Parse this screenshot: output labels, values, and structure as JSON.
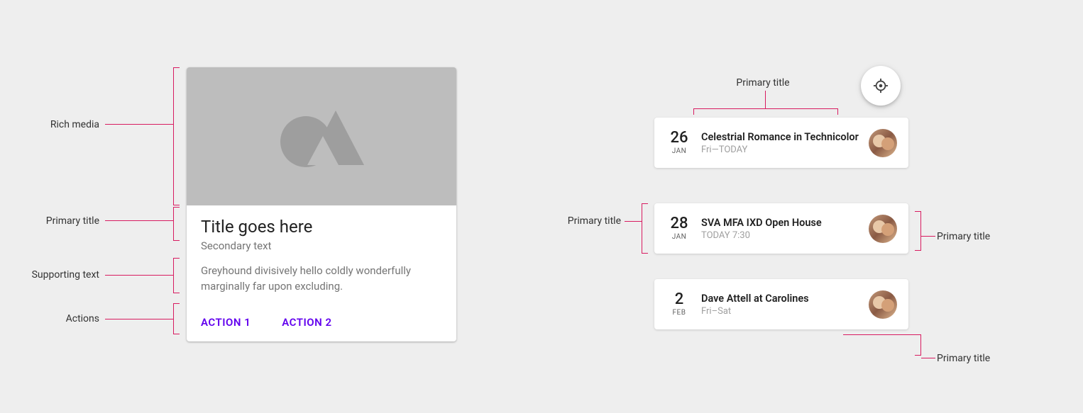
{
  "left": {
    "annotations": {
      "rich_media": "Rich media",
      "primary_title": "Primary title",
      "supporting_text": "Supporting text",
      "actions": "Actions"
    },
    "card": {
      "title": "Title goes here",
      "secondary": "Secondary text",
      "supporting": "Greyhound divisively hello coldly wonderfully marginally far upon excluding.",
      "action1": "ACTION 1",
      "action2": "ACTION 2"
    }
  },
  "right": {
    "top_label": "Primary title",
    "left_label": "Primary title",
    "right_label_1": "Primary title",
    "right_label_2": "Primary title",
    "events": [
      {
        "day": "26",
        "month": "JAN",
        "title": "Celestrial Romance in Technicolor",
        "sub": "Fri—TODAY"
      },
      {
        "day": "28",
        "month": "JAN",
        "title": "SVA MFA IXD Open House",
        "sub": "TODAY 7:30"
      },
      {
        "day": "2",
        "month": "FEB",
        "title": "Dave Attell at Carolines",
        "sub": "Fri–Sat"
      }
    ]
  }
}
